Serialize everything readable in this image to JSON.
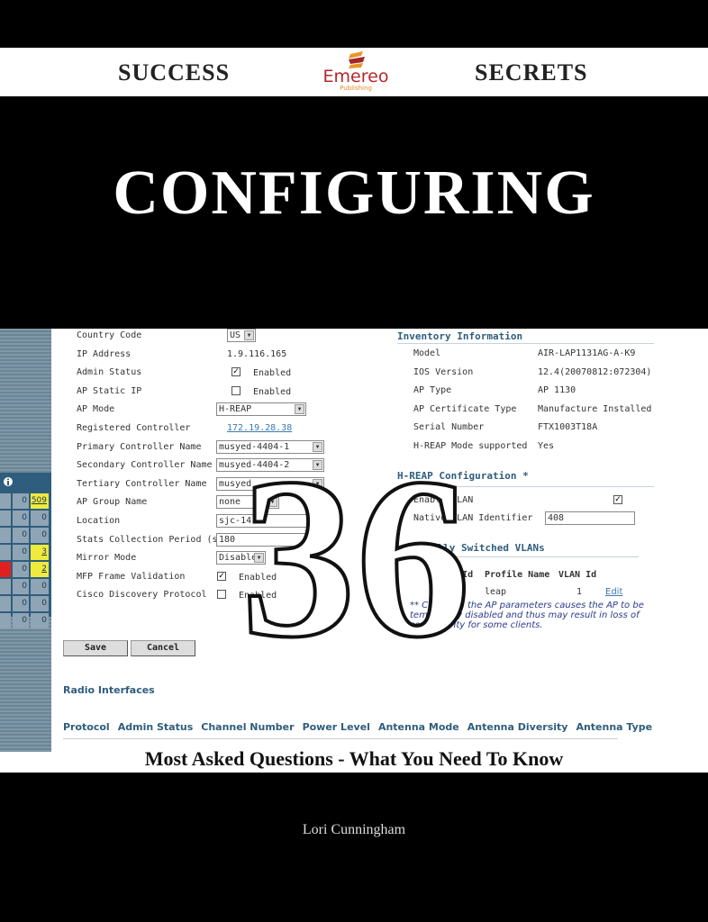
{
  "header": {
    "left": "SUCCESS",
    "right": "SECRETS",
    "publisher": "Emereo",
    "publisher_sub": "Publishing"
  },
  "title": "CONFIGURING",
  "number": "36",
  "subtitle": "Most Asked Questions - What You Need To Know",
  "author": "Lori Cunningham",
  "screenshot": {
    "side_table": {
      "rows": [
        [
          "0",
          "509"
        ],
        [
          "0",
          "0"
        ],
        [
          "0",
          "0"
        ],
        [
          "0",
          "3"
        ],
        [
          "0",
          "2"
        ],
        [
          "0",
          "0"
        ],
        [
          "0",
          "0"
        ],
        [
          "0",
          "0"
        ]
      ]
    },
    "left_fields": [
      {
        "label": "Country Code",
        "value": "US",
        "type": "select"
      },
      {
        "label": "IP Address",
        "value": "1.9.116.165",
        "type": "text"
      },
      {
        "label": "Admin Status",
        "value": "Enabled",
        "type": "checkbox",
        "checked": true
      },
      {
        "label": "AP Static IP",
        "value": "Enabled",
        "type": "checkbox",
        "checked": false
      },
      {
        "label": "AP Mode",
        "value": "H-REAP",
        "type": "select"
      },
      {
        "label": "Registered Controller",
        "value": "172.19.28.38",
        "type": "link"
      },
      {
        "label": "Primary Controller Name",
        "value": "musyed-4404-1",
        "type": "select"
      },
      {
        "label": "Secondary Controller Name",
        "value": "musyed-4404-2",
        "type": "select"
      },
      {
        "label": "Tertiary Controller Name",
        "value": "musyed",
        "type": "select"
      },
      {
        "label": "AP Group Name",
        "value": "none",
        "type": "select"
      },
      {
        "label": "Location",
        "value": "sjc-14",
        "type": "input"
      },
      {
        "label": "Stats Collection Period (sec)",
        "value": "180",
        "type": "input"
      },
      {
        "label": "Mirror Mode",
        "value": "Disable",
        "type": "select"
      },
      {
        "label": "MFP Frame Validation",
        "value": "Enabled",
        "type": "checkbox",
        "checked": true
      },
      {
        "label": "Cisco Discovery Protocol",
        "value": "Enabled",
        "type": "checkbox",
        "checked": false
      }
    ],
    "inventory_heading": "Inventory Information",
    "inventory": [
      {
        "label": "Model",
        "value": "AIR-LAP1131AG-A-K9"
      },
      {
        "label": "IOS Version",
        "value": "12.4(20070812:072304)"
      },
      {
        "label": "AP Type",
        "value": "AP 1130"
      },
      {
        "label": "AP Certificate Type",
        "value": "Manufacture Installed"
      },
      {
        "label": "Serial Number",
        "value": "FTX1003T18A"
      },
      {
        "label": "H-REAP Mode supported",
        "value": "Yes"
      }
    ],
    "hreap_heading": "H-REAP Configuration *",
    "vlan_label": "Enable VLAN",
    "native_vlan_label": "Native VLAN Identifier",
    "native_vlan_value": "408",
    "local_vlans_heading": "Locally Switched VLANs",
    "vlan_table_headers": [
      "WLAN Id",
      "Profile Name",
      "VLAN Id"
    ],
    "vlan_row": {
      "profile": "leap",
      "vlan": "1",
      "action": "Edit"
    },
    "note": "** Changing the AP parameters causes the AP to be temporarily disabled and thus may result in loss of connectivity for some clients.",
    "save": "Save",
    "cancel": "Cancel",
    "radio_heading": "Radio Interfaces",
    "radio_columns": [
      "Protocol",
      "Admin Status",
      "Channel Number",
      "Power Level",
      "Antenna Mode",
      "Antenna Diversity",
      "Antenna Type"
    ]
  },
  "colors": {
    "accent": "#2f5d7d",
    "highlight": "#f0ea3c",
    "alert": "#e02020"
  }
}
